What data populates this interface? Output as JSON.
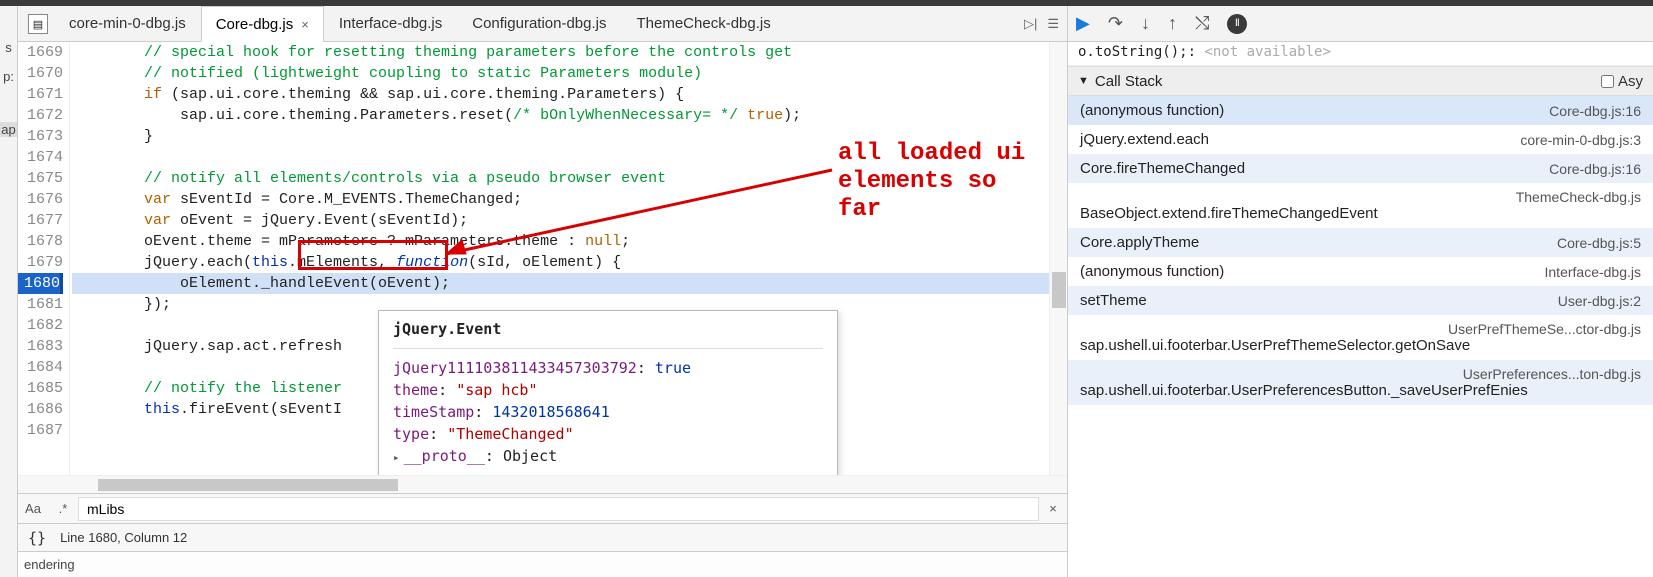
{
  "tabs": {
    "t0": "core-min-0-dbg.js",
    "t1": "Core-dbg.js",
    "active_close": "×",
    "t2": "Interface-dbg.js",
    "t3": "Configuration-dbg.js",
    "t4": "ThemeCheck-dbg.js"
  },
  "gutter": {
    "l1669": "1669",
    "l1670": "1670",
    "l1671": "1671",
    "l1672": "1672",
    "l1673": "1673",
    "l1674": "1674",
    "l1675": "1675",
    "l1676": "1676",
    "l1677": "1677",
    "l1678": "1678",
    "l1679": "1679",
    "l1680": "1680",
    "l1681": "1681",
    "l1682": "1682",
    "l1683": "1683",
    "l1684": "1684",
    "l1685": "1685",
    "l1686": "1686",
    "l1687": "1687"
  },
  "code": {
    "c1669": "        // special hook for resetting theming parameters before the controls get",
    "c1670": "        // notified (lightweight coupling to static Parameters module)",
    "c1671a": "        ",
    "c1671b": "if",
    "c1671c": " (sap.ui.core.theming && sap.ui.core.theming.Parameters) {",
    "c1672a": "            sap.ui.core.theming.Parameters.reset(",
    "c1672b": "/* bOnlyWhenNecessary= */",
    "c1672c": " ",
    "c1672d": "true",
    "c1672e": ");",
    "c1673": "        }",
    "c1674": "",
    "c1675": "        // notify all elements/controls via a pseudo browser event",
    "c1676a": "        ",
    "c1676b": "var",
    "c1676c": " sEventId = Core.M_EVENTS.ThemeChanged;",
    "c1677a": "        ",
    "c1677b": "var",
    "c1677c": " oEvent = jQuery.Event(sEventId);",
    "c1678a": "        oEvent.theme = mParameters ? mParameters.theme : ",
    "c1678b": "null",
    "c1678c": ";",
    "c1679a": "        jQuery.each(",
    "c1679b": "this",
    "c1679c": ".mElements, ",
    "c1679d": "function",
    "c1679e": "(sId, oElement) {",
    "c1680": "            oElement._handleEvent(oEvent);",
    "c1681": "        });",
    "c1682": "",
    "c1683": "        jQuery.sap.act.refresh",
    "c1684": "",
    "c1685": "        // notify the listener",
    "c1686a": "        ",
    "c1686b": "this",
    "c1686c": ".fireEvent(sEventI"
  },
  "search": {
    "value": "mLibs",
    "aa": "Aa",
    "rx": ".*",
    "close": "×"
  },
  "status": {
    "braces": "{}",
    "pos": "Line 1680, Column 12"
  },
  "bottom": {
    "label": "endering"
  },
  "annotation": {
    "line1": "all loaded ui",
    "line2": "elements so",
    "line3": "far"
  },
  "tooltip": {
    "title": "jQuery.Event",
    "row1_key": "jQuery111103811433457303792",
    "row1_val": "true",
    "row2_key": "theme",
    "row2_val": "\"sap hcb\"",
    "row3_key": "timeStamp",
    "row3_val": "1432018568641",
    "row4_key": "type",
    "row4_val": "\"ThemeChanged\"",
    "row5_key": "__proto__",
    "row5_val": "Object",
    "rarrow": "▸"
  },
  "dbg": {
    "watch_expr": "o.toString();:",
    "watch_na": "<not available>",
    "callstack": "Call Stack",
    "async_label": "Asy",
    "frames": {
      "f0_fn": "(anonymous function)",
      "f0_src": "Core-dbg.js:16",
      "f1_fn": "jQuery.extend.each",
      "f1_src": "core-min-0-dbg.js:3",
      "f2_fn": "Core.fireThemeChanged",
      "f2_src": "Core-dbg.js:16",
      "f3_src": "ThemeCheck-dbg.js",
      "f3_fn": "BaseObject.extend.fireThemeChangedEvent",
      "f4_fn": "Core.applyTheme",
      "f4_src": "Core-dbg.js:5",
      "f5_fn": "(anonymous function)",
      "f5_src": "Interface-dbg.js",
      "f6_fn": "setTheme",
      "f6_src": "User-dbg.js:2",
      "f7_src": "UserPrefThemeSe...ctor-dbg.js",
      "f7_fn": "sap.ushell.ui.footerbar.UserPrefThemeSelector.getOnSave",
      "f8_src": "UserPreferences...ton-dbg.js",
      "f8_fn": "sap.ushell.ui.footerbar.UserPreferencesButton._saveUserPrefEnies"
    }
  },
  "left": {
    "s": "s",
    "p": "p:",
    "ap": "ap"
  }
}
